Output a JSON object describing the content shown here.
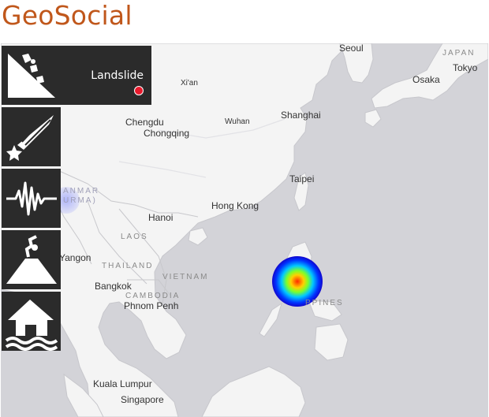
{
  "app": {
    "title": "GeoSocial"
  },
  "layers": {
    "active": {
      "label": "Landslide",
      "icon": "landslide-icon",
      "indicator_color": "#e8192c"
    },
    "items": [
      {
        "name": "meteor",
        "icon": "meteor-icon"
      },
      {
        "name": "earthquake",
        "icon": "earthquake-icon"
      },
      {
        "name": "volcano",
        "icon": "volcano-icon"
      },
      {
        "name": "flood",
        "icon": "flood-icon"
      }
    ]
  },
  "map": {
    "cities": {
      "seoul": "Seoul",
      "tokyo": "Tokyo",
      "osaka": "Osaka",
      "xian": "Xi'an",
      "chengdu": "Chengdu",
      "chongqing": "Chongqing",
      "wuhan": "Wuhan",
      "shanghai": "Shanghai",
      "taipei": "Taipei",
      "hong_kong": "Hong Kong",
      "hanoi": "Hanoi",
      "yangon": "Yangon",
      "bangkok": "Bangkok",
      "phnom_penh": "Phnom Penh",
      "kuala_lumpur": "Kuala Lumpur",
      "singapore": "Singapore"
    },
    "countries": {
      "japan": "JAPAN",
      "myanmar_1": "ANMAR",
      "myanmar_2": "URMA)",
      "laos": "LAOS",
      "thailand": "THAILAND",
      "vietnam": "VIETNAM",
      "cambodia": "CAMBODIA",
      "philippines": "PPINES"
    },
    "heatmap": {
      "colors": [
        "#ff2a00",
        "#ffd000",
        "#7dff2a",
        "#00c8ff",
        "#0033ff"
      ]
    }
  }
}
